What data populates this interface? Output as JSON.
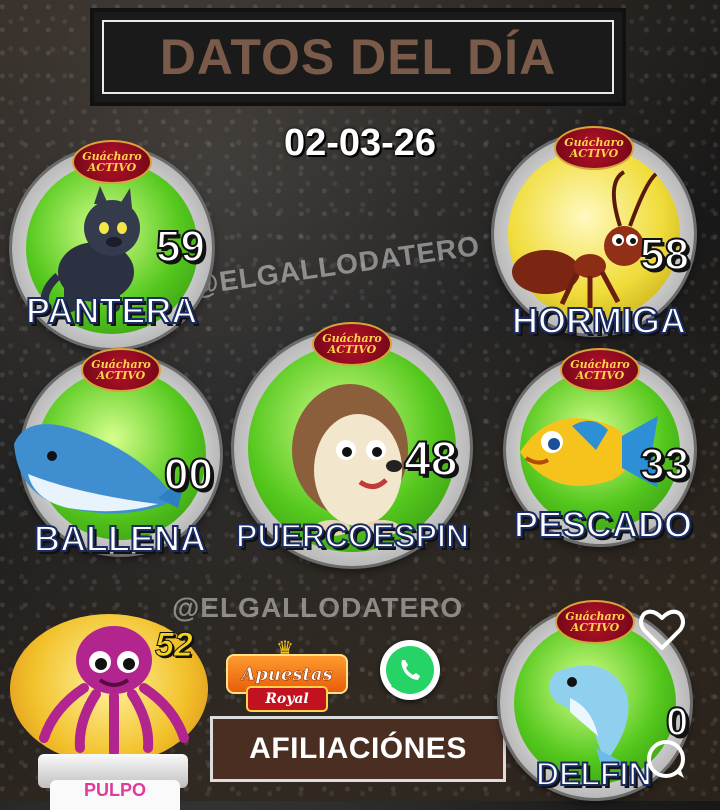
{
  "header": {
    "title": "DATOS DEL DÍA"
  },
  "date": "02-03-26",
  "watermarks": [
    "@ELGALLODATERO",
    "@ELGALLODATERO"
  ],
  "medals": [
    {
      "id": "pantera",
      "number": "59",
      "label": "PANTERA",
      "badge": [
        "Guácharo",
        "ACTIVO"
      ]
    },
    {
      "id": "hormiga",
      "number": "58",
      "label": "HORMIGA",
      "badge": [
        "Guácharo",
        "ACTIVO"
      ]
    },
    {
      "id": "ballena",
      "number": "00",
      "label": "BALLENA",
      "badge": [
        "Guácharo",
        "ACTIVO"
      ]
    },
    {
      "id": "puercoespin",
      "number": "48",
      "label": "PUERCOESPIN",
      "badge": [
        "Guácharo",
        "ACTIVO"
      ]
    },
    {
      "id": "pescado",
      "number": "33",
      "label": "PESCADO",
      "badge": [
        "Guácharo",
        "ACTIVO"
      ]
    },
    {
      "id": "delfin",
      "number": "0",
      "label": "DELFIN",
      "badge": [
        "Guácharo",
        "ACTIVO"
      ]
    }
  ],
  "pulpo": {
    "number": "52",
    "label": "PULPO"
  },
  "sponsor": {
    "top": "Apuestas",
    "bottom": "Royal"
  },
  "affiliations": {
    "label": "AFILIACIÓNES"
  },
  "icons": {
    "heart": "heart-icon",
    "comment": "comment-icon",
    "whatsapp": "whatsapp-icon",
    "crown": "crown-icon"
  },
  "colors": {
    "title_text": "#7a5a49",
    "label_stroke": "#1a2c63",
    "whatsapp_green": "#25d366",
    "green_disc": "#55c81e",
    "yellow_disc": "#f0dc3a"
  }
}
